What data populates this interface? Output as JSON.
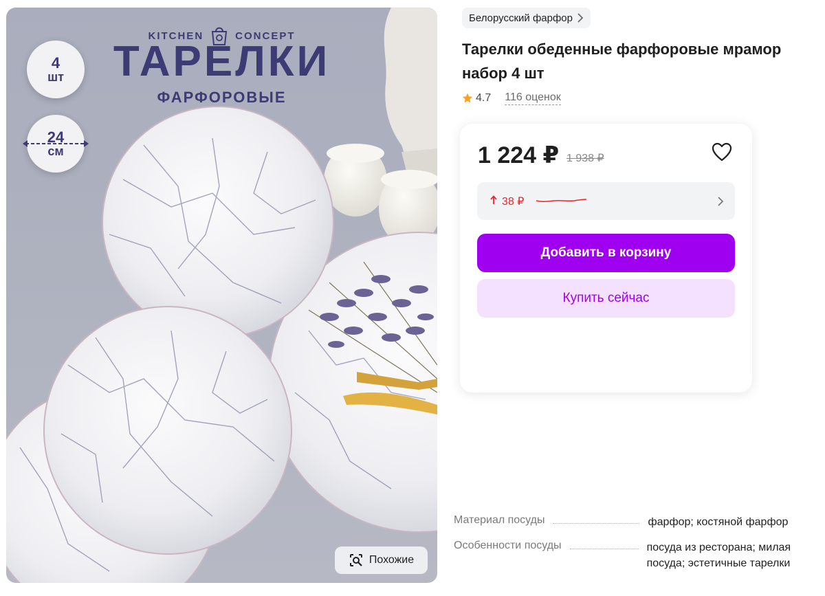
{
  "image": {
    "brand_left": "KITCHEN",
    "brand_right": "CONCEPT",
    "headline": "ТАРЕЛКИ",
    "subheadline": "ФАРФОРОВЫЕ",
    "badge_qty_num": "4",
    "badge_qty_unit": "шт",
    "badge_size_num": "24",
    "badge_size_unit": "см",
    "similar_label": "Похожие"
  },
  "brand": {
    "label": "Белорусский фарфор"
  },
  "product": {
    "title_line1": "Тарелки обеденные фарфоровые мрамор",
    "title_line2": "набор 4 шт",
    "rating": "4.7",
    "reviews": "116 оценок"
  },
  "price": {
    "current": "1 224 ₽",
    "old": "1 938 ₽",
    "change": "38 ₽",
    "change_color": "#f0242d"
  },
  "actions": {
    "add_to_cart": "Добавить в корзину",
    "buy_now": "Купить сейчас",
    "accent": "#a000f0"
  },
  "specs": [
    {
      "name": "Материал посуды",
      "value": "фарфор; костяной фарфор"
    },
    {
      "name": "Особенности посуды",
      "value": "посуда из ресторана; милая посуда; эстетичные тарелки"
    }
  ],
  "icons": {
    "brand_chevron": "chevron-right-icon",
    "rating": "star-icon",
    "favorite": "heart-icon",
    "price_up": "arrow-up-icon",
    "price_expand": "chevron-right-icon",
    "similar": "image-search-icon"
  }
}
